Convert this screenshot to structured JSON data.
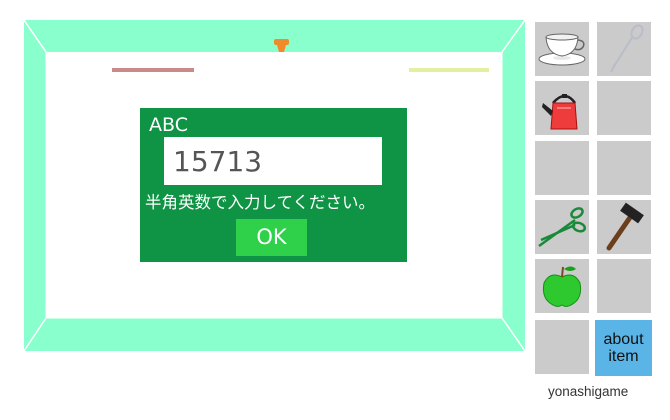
{
  "dialog": {
    "title": "ABC",
    "input_value": "15713",
    "hint": "半角英数で入力してください。",
    "ok_label": "OK"
  },
  "colors": {
    "room_frame": "#88ffcc",
    "dialog_bg": "#0f9445",
    "ok_button": "#2fd14a",
    "slot_bg": "#cbcbcb",
    "about_bg": "#5ab4e6"
  },
  "inventory": {
    "items": [
      {
        "icon": "teacup-icon"
      },
      {
        "icon": "wire-loop-icon"
      },
      {
        "icon": "kettle-icon"
      },
      {
        "icon": "empty"
      },
      {
        "icon": "empty"
      },
      {
        "icon": "empty"
      },
      {
        "icon": "scissors-icon"
      },
      {
        "icon": "hammer-icon"
      },
      {
        "icon": "apple-icon"
      },
      {
        "icon": "empty"
      },
      {
        "icon": "empty"
      }
    ],
    "about_line1": "about",
    "about_line2": "item"
  },
  "footer": {
    "credit": "yonashigame"
  }
}
